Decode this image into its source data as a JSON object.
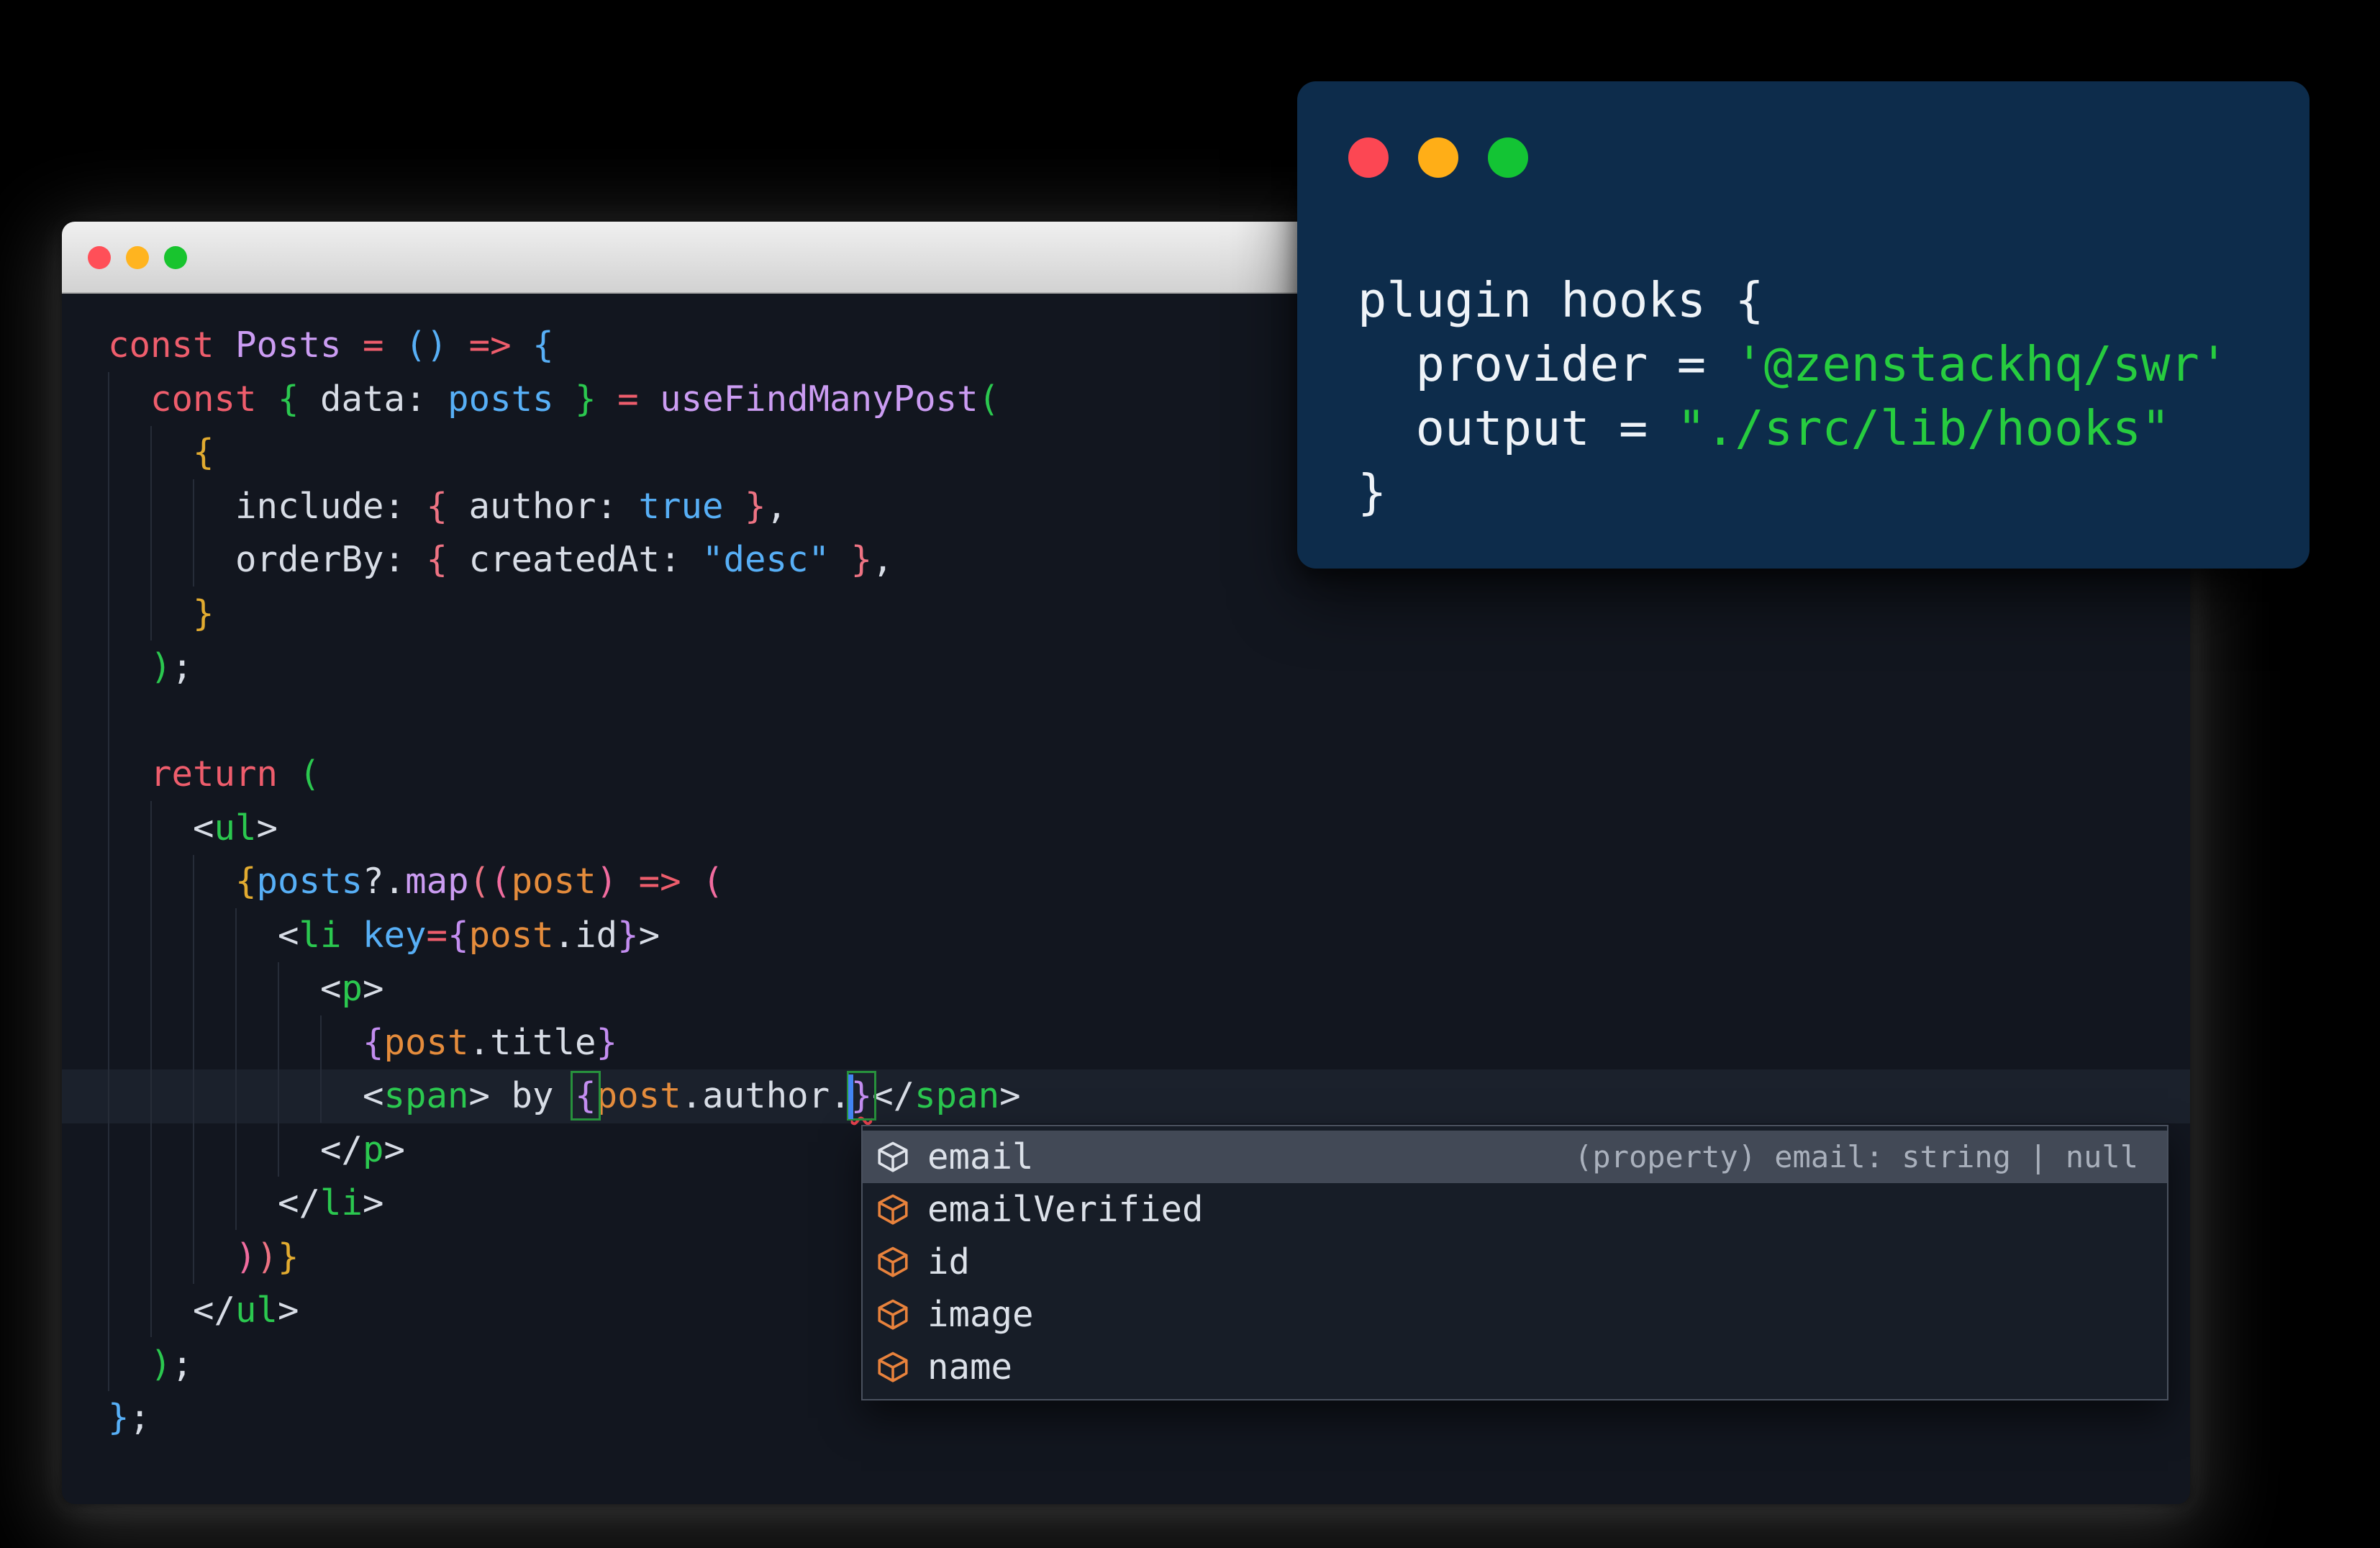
{
  "colors": {
    "ui": {
      "page-bg": "#000000",
      "editor-bg": "#12161f",
      "current-line": "#1b212c",
      "guide": "#262c38",
      "titlebar-top": "#f0f0f0",
      "titlebar-bottom": "#d2d2d2",
      "titlebar-border": "#aeaeae",
      "overlay-bg": "#0d2c4b",
      "overlay-fg": "#eef3f8",
      "dd-bg": "#171d27",
      "dd-border": "#4a515e",
      "dd-selected": "#424956",
      "dd-label": "#dce1e9",
      "dd-hint": "#a9b0bc",
      "icon-orange": "#e8823c",
      "icon-white": "#dfe3ea",
      "match": "#27913c",
      "squiggle": "#e8414d",
      "cursor": "#4285f4"
    },
    "syntax": {
      "k": "#ee5d6c",
      "f": "#cb9cf2",
      "v": "#57aff6",
      "g": "#2bc84f",
      "y": "#e2ab30",
      "s": "#ee7383",
      "p": "#f16c9f",
      "u": "#c38df0",
      "o": "#e58c3c",
      "w": "#d8dde6",
      "str": "#27cc3f"
    }
  },
  "main_window": {
    "traffic_lights": [
      "#ff4f58",
      "#ffb41f",
      "#18c42e"
    ],
    "editor": {
      "lines": [
        {
          "segs": [
            {
              "t": "const ",
              "c": "k"
            },
            {
              "t": "Posts ",
              "c": "f"
            },
            {
              "t": "= ",
              "c": "k"
            },
            {
              "t": "() ",
              "c": "v"
            },
            {
              "t": "=> ",
              "c": "k"
            },
            {
              "t": "{",
              "c": "v"
            }
          ]
        },
        {
          "segs": [
            {
              "t": "  ",
              "c": "w"
            },
            {
              "t": "const ",
              "c": "k"
            },
            {
              "t": "{ ",
              "c": "g"
            },
            {
              "t": "data: ",
              "c": "w"
            },
            {
              "t": "posts ",
              "c": "v"
            },
            {
              "t": "} ",
              "c": "g"
            },
            {
              "t": "= ",
              "c": "k"
            },
            {
              "t": "useFindManyPost",
              "c": "f"
            },
            {
              "t": "(",
              "c": "g"
            }
          ]
        },
        {
          "segs": [
            {
              "t": "    ",
              "c": "w"
            },
            {
              "t": "{",
              "c": "y"
            }
          ]
        },
        {
          "segs": [
            {
              "t": "      include: ",
              "c": "w"
            },
            {
              "t": "{ ",
              "c": "s"
            },
            {
              "t": "author: ",
              "c": "w"
            },
            {
              "t": "true",
              "c": "v"
            },
            {
              "t": " }",
              "c": "s"
            },
            {
              "t": ",",
              "c": "w"
            }
          ]
        },
        {
          "segs": [
            {
              "t": "      orderBy: ",
              "c": "w"
            },
            {
              "t": "{ ",
              "c": "s"
            },
            {
              "t": "createdAt: ",
              "c": "w"
            },
            {
              "t": "\"desc\"",
              "c": "v"
            },
            {
              "t": " }",
              "c": "s"
            },
            {
              "t": ",",
              "c": "w"
            }
          ]
        },
        {
          "segs": [
            {
              "t": "    ",
              "c": "w"
            },
            {
              "t": "}",
              "c": "y"
            }
          ]
        },
        {
          "segs": [
            {
              "t": "  ",
              "c": "w"
            },
            {
              "t": ")",
              "c": "g"
            },
            {
              "t": ";",
              "c": "w"
            }
          ]
        },
        {
          "segs": []
        },
        {
          "segs": [
            {
              "t": "  ",
              "c": "w"
            },
            {
              "t": "return ",
              "c": "k"
            },
            {
              "t": "(",
              "c": "g"
            }
          ]
        },
        {
          "segs": [
            {
              "t": "    <",
              "c": "w"
            },
            {
              "t": "ul",
              "c": "g"
            },
            {
              "t": ">",
              "c": "w"
            }
          ]
        },
        {
          "segs": [
            {
              "t": "      ",
              "c": "w"
            },
            {
              "t": "{",
              "c": "y"
            },
            {
              "t": "posts",
              "c": "v"
            },
            {
              "t": "?.",
              "c": "w"
            },
            {
              "t": "map",
              "c": "f"
            },
            {
              "t": "(",
              "c": "s"
            },
            {
              "t": "(",
              "c": "p"
            },
            {
              "t": "post",
              "c": "o"
            },
            {
              "t": ")",
              "c": "p"
            },
            {
              "t": " ",
              "c": "w"
            },
            {
              "t": "=> ",
              "c": "k"
            },
            {
              "t": "(",
              "c": "p"
            }
          ]
        },
        {
          "segs": [
            {
              "t": "        <",
              "c": "w"
            },
            {
              "t": "li ",
              "c": "g"
            },
            {
              "t": "key",
              "c": "v"
            },
            {
              "t": "=",
              "c": "k"
            },
            {
              "t": "{",
              "c": "u"
            },
            {
              "t": "post",
              "c": "o"
            },
            {
              "t": ".id",
              "c": "w"
            },
            {
              "t": "}",
              "c": "u"
            },
            {
              "t": ">",
              "c": "w"
            }
          ]
        },
        {
          "segs": [
            {
              "t": "          <",
              "c": "w"
            },
            {
              "t": "p",
              "c": "g"
            },
            {
              "t": ">",
              "c": "w"
            }
          ]
        },
        {
          "segs": [
            {
              "t": "            ",
              "c": "w"
            },
            {
              "t": "{",
              "c": "u"
            },
            {
              "t": "post",
              "c": "o"
            },
            {
              "t": ".title",
              "c": "w"
            },
            {
              "t": "}",
              "c": "u"
            }
          ]
        },
        {
          "segs": [
            {
              "t": "            <",
              "c": "w"
            },
            {
              "t": "span",
              "c": "g"
            },
            {
              "t": "> ",
              "c": "w"
            },
            {
              "t": "by ",
              "c": "w"
            },
            {
              "t": "{",
              "c": "u",
              "box": true
            },
            {
              "t": "post",
              "c": "o"
            },
            {
              "t": ".author.",
              "c": "w"
            },
            {
              "cursor": true
            },
            {
              "t": "}",
              "c": "u",
              "box": true,
              "sq": true
            },
            {
              "t": "</",
              "c": "w"
            },
            {
              "t": "span",
              "c": "g"
            },
            {
              "t": ">",
              "c": "w"
            }
          ]
        },
        {
          "segs": [
            {
              "t": "          </",
              "c": "w"
            },
            {
              "t": "p",
              "c": "g"
            },
            {
              "t": ">",
              "c": "w"
            }
          ]
        },
        {
          "segs": [
            {
              "t": "        </",
              "c": "w"
            },
            {
              "t": "li",
              "c": "g"
            },
            {
              "t": ">",
              "c": "w"
            }
          ]
        },
        {
          "segs": [
            {
              "t": "      ",
              "c": "w"
            },
            {
              "t": ")",
              "c": "p"
            },
            {
              "t": ")",
              "c": "s"
            },
            {
              "t": "}",
              "c": "y"
            }
          ]
        },
        {
          "segs": [
            {
              "t": "    </",
              "c": "w"
            },
            {
              "t": "ul",
              "c": "g"
            },
            {
              "t": ">",
              "c": "w"
            }
          ]
        },
        {
          "segs": [
            {
              "t": "  ",
              "c": "w"
            },
            {
              "t": ")",
              "c": "g"
            },
            {
              "t": ";",
              "c": "w"
            }
          ]
        },
        {
          "segs": [
            {
              "t": "}",
              "c": "v"
            },
            {
              "t": ";",
              "c": "w"
            }
          ]
        }
      ]
    }
  },
  "suggest": {
    "items": [
      {
        "label": "email",
        "hint": "(property) email: string | null",
        "selected": true
      },
      {
        "label": "emailVerified"
      },
      {
        "label": "id"
      },
      {
        "label": "image"
      },
      {
        "label": "name"
      }
    ]
  },
  "overlay_window": {
    "traffic_lights": [
      "#fc4753",
      "#ffae17",
      "#13c434"
    ],
    "lines": [
      {
        "segs": [
          {
            "t": "plugin hooks {",
            "c": "w"
          }
        ]
      },
      {
        "segs": [
          {
            "t": "  provider = ",
            "c": "w"
          },
          {
            "t": "'@zenstackhq/swr'",
            "c": "str"
          }
        ]
      },
      {
        "segs": [
          {
            "t": "  output = ",
            "c": "w"
          },
          {
            "t": "\"./src/lib/hooks\"",
            "c": "str"
          }
        ]
      },
      {
        "segs": [
          {
            "t": "}",
            "c": "w"
          }
        ]
      }
    ]
  }
}
